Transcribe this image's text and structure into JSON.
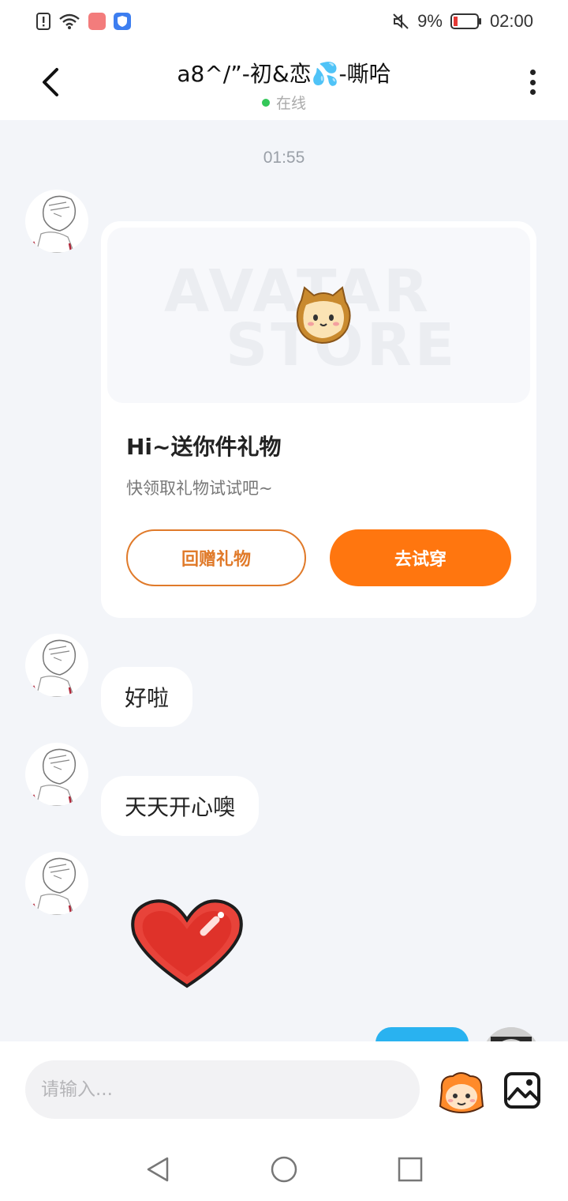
{
  "status_bar": {
    "battery": "9%",
    "time": "02:00",
    "icons": [
      "sim-alert-icon",
      "wifi-icon",
      "huawei-app-icon",
      "shield-app-icon",
      "mute-icon",
      "battery-icon"
    ],
    "battery_low_color": "#e53935"
  },
  "header": {
    "title": "a8^/”-初&恋💦-嘶哈",
    "online_status": "在线",
    "online_color": "#34c759"
  },
  "chat": {
    "timestamp": "01:55",
    "gift_card": {
      "banner_line1": "AVATAR",
      "banner_line2": "STORE",
      "title": "Hi~送你件礼物",
      "subtitle": "快领取礼物试试吧~",
      "return_gift_label": "回赠礼物",
      "try_on_label": "去试穿",
      "accent_color": "#ff760f"
    },
    "messages": [
      {
        "text": "好啦"
      },
      {
        "text": "天天开心噢"
      }
    ],
    "sticker": "heart-sticker",
    "outgoing_bubble_color": "#29b2f0"
  },
  "input": {
    "placeholder": "请输入..."
  }
}
